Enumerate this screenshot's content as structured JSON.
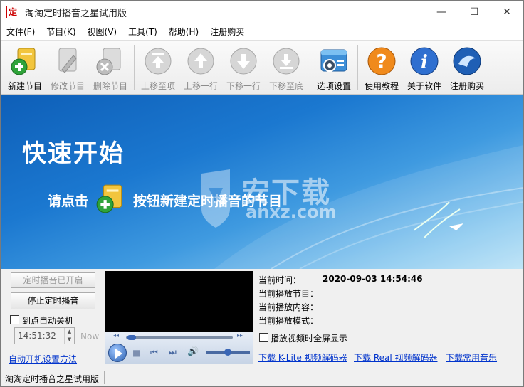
{
  "window": {
    "title": "淘淘定时播音之星试用版",
    "app_icon_char": "定",
    "minimize_glyph": "—",
    "maximize_glyph": "☐",
    "close_glyph": "✕"
  },
  "menu": {
    "items": [
      "文件(F)",
      "节目(K)",
      "视图(V)",
      "工具(T)",
      "帮助(H)",
      "注册购买"
    ]
  },
  "toolbar": {
    "new_program": "新建节目",
    "edit_program": "修改节目",
    "delete_program": "删除节目",
    "move_top": "上移至项",
    "move_up": "上移一行",
    "move_down": "下移一行",
    "move_bottom": "下移至底",
    "options": "选项设置",
    "tutorial": "使用教程",
    "about": "关于软件",
    "register": "注册购买"
  },
  "banner": {
    "title": "快速开始",
    "hint_prefix": "请点击",
    "hint_suffix": "按钮新建定时播音的节目",
    "watermark": "安下载",
    "watermark_sub": "anxz.com"
  },
  "controls": {
    "timed_on_label": "定时播音已开启",
    "stop_label": "停止定时播音",
    "auto_shutdown_label": "到点自动关机",
    "time_value": "14:51:32",
    "now_label": "Now",
    "auto_boot_link": "自动开机设置方法"
  },
  "info": {
    "current_time_label": "当前时间：",
    "current_time_value": "2020-09-03 14:54:46",
    "current_program_label": "当前播放节目：",
    "current_content_label": "当前播放内容：",
    "current_mode_label": "当前播放模式：",
    "fullscreen_label": "播放视频时全屏显示"
  },
  "links": {
    "klite": "下载 K-Lite 视频解码器",
    "real": "下载 Real 视频解码器",
    "music": "下载常用音乐"
  },
  "status": {
    "text": "淘淘定时播音之星试用版"
  },
  "colors": {
    "banner_start": "#0e5fb8",
    "banner_end": "#b9e2f6",
    "link": "#0033cc"
  }
}
